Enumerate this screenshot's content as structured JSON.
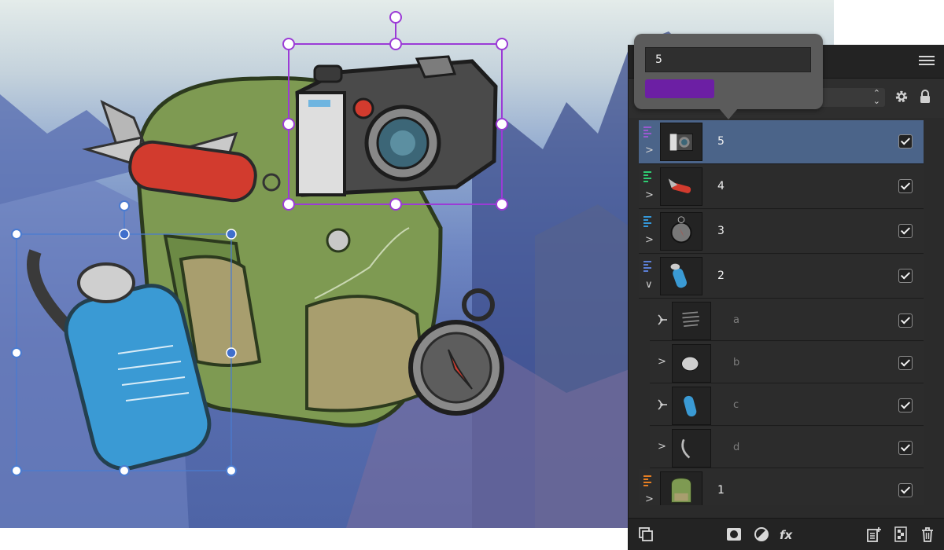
{
  "popup": {
    "name_value": "5",
    "swatch_color": "#6c1fa4"
  },
  "layers": [
    {
      "id": "5",
      "name": "5",
      "tag_color": "#9b59d0",
      "selected": true,
      "visible": true,
      "expanded": false,
      "thumb": "camera"
    },
    {
      "id": "4",
      "name": "4",
      "tag_color": "#2ecc71",
      "selected": false,
      "visible": true,
      "expanded": false,
      "thumb": "knife"
    },
    {
      "id": "3",
      "name": "3",
      "tag_color": "#3498db",
      "selected": false,
      "visible": true,
      "expanded": false,
      "thumb": "compass"
    },
    {
      "id": "2",
      "name": "2",
      "tag_color": "#5b7fd6",
      "selected": false,
      "visible": true,
      "expanded": true,
      "thumb": "bottle"
    },
    {
      "id": "a",
      "name": "a",
      "child": true,
      "icon": "vector-node-icon",
      "visible": true,
      "thumb": "scribble"
    },
    {
      "id": "b",
      "name": "b",
      "child": true,
      "icon": "chevron-right-icon",
      "visible": true,
      "thumb": "cap"
    },
    {
      "id": "c",
      "name": "c",
      "child": true,
      "icon": "vector-node-icon",
      "visible": true,
      "thumb": "bottle-body"
    },
    {
      "id": "d",
      "name": "d",
      "child": true,
      "icon": "chevron-right-icon",
      "visible": true,
      "thumb": "strap"
    },
    {
      "id": "1",
      "name": "1",
      "tag_color": "#e67e22",
      "selected": false,
      "visible": true,
      "expanded": false,
      "thumb": "backpack"
    }
  ],
  "icons": {
    "panel_menu": "hamburger-menu-icon",
    "settings": "gear-icon",
    "lock": "lock-icon",
    "bottom": [
      "arrange-layers-icon",
      "mask-icon",
      "adjustment-icon",
      "fx-icon",
      "add-layer-icon",
      "checkerboard-icon",
      "trash-icon"
    ]
  },
  "colors": {
    "selection_purple": "#9b3bd6",
    "selection_blue": "#4a7bd0",
    "selected_row": "#4b6489"
  }
}
